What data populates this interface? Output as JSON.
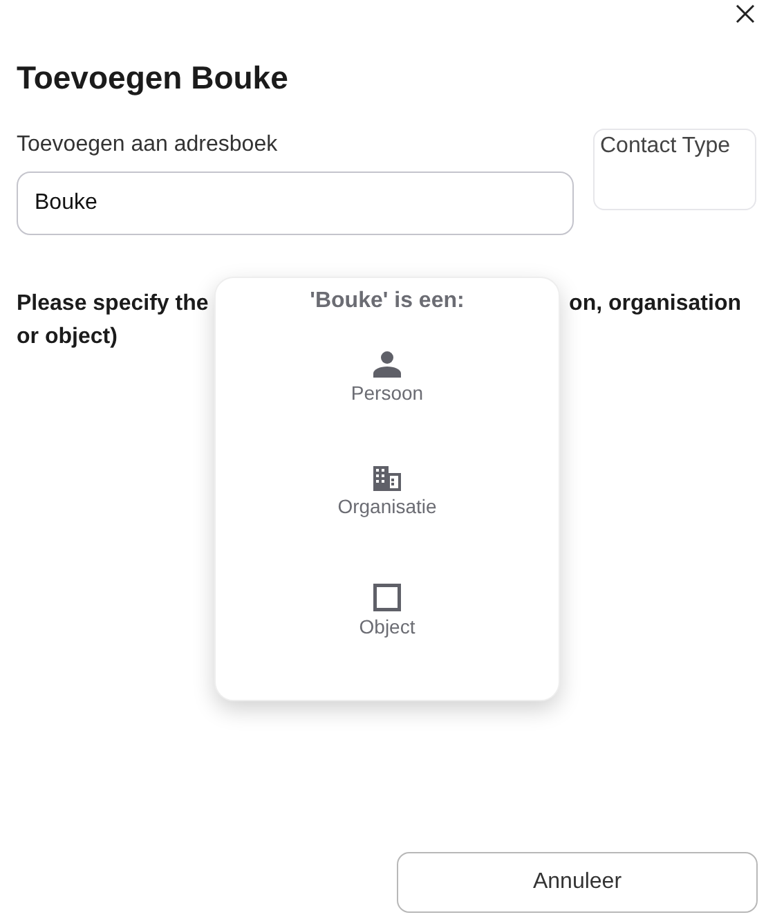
{
  "title": "Toevoegen Bouke",
  "addressbook": {
    "label": "Toevoegen aan adresboek",
    "value": "Bouke"
  },
  "contact_type": {
    "label": "Contact Type"
  },
  "instruction": {
    "line_1_start": "Please specify the",
    "line_1_end": "on, organisation",
    "line_2": "or object)"
  },
  "popup": {
    "heading": "'Bouke' is een:",
    "options": [
      {
        "kind": "person",
        "label": "Persoon"
      },
      {
        "kind": "organisation",
        "label": "Organisatie"
      },
      {
        "kind": "object",
        "label": "Object"
      }
    ]
  },
  "buttons": [
    "Annuleer"
  ]
}
